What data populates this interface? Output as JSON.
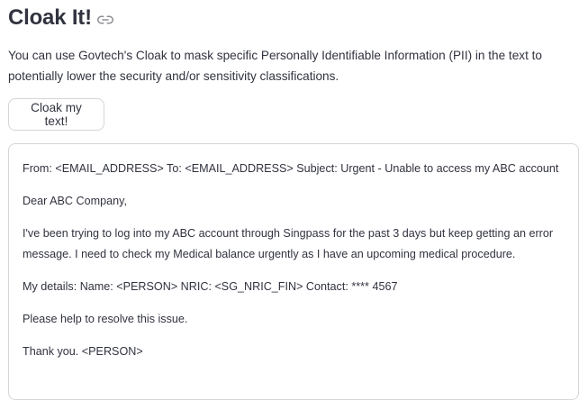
{
  "header": {
    "title": "Cloak It!",
    "anchor_icon": "link-icon"
  },
  "intro": {
    "text": "You can use Govtech's Cloak to mask specific Personally Identifiable Information (PII) in the text to potentially lower the security and/or sensitivity classifications."
  },
  "actions": {
    "cloak_button_label": "Cloak my text!"
  },
  "result": {
    "paragraphs": [
      "From: <EMAIL_ADDRESS> To: <EMAIL_ADDRESS> Subject: Urgent - Unable to access my ABC account",
      "Dear ABC Company,",
      "I've been trying to log into my ABC account through Singpass for the past 3 days but keep getting an error message. I need to check my Medical balance urgently as I have an upcoming medical procedure.",
      "My details: Name: <PERSON> NRIC: <SG_NRIC_FIN> Contact: **** 4567",
      "Please help to resolve this issue.",
      "Thank you. <PERSON>"
    ]
  },
  "colors": {
    "text": "#31333f",
    "border": "#d6d6d9",
    "icon": "#8d8e95"
  }
}
